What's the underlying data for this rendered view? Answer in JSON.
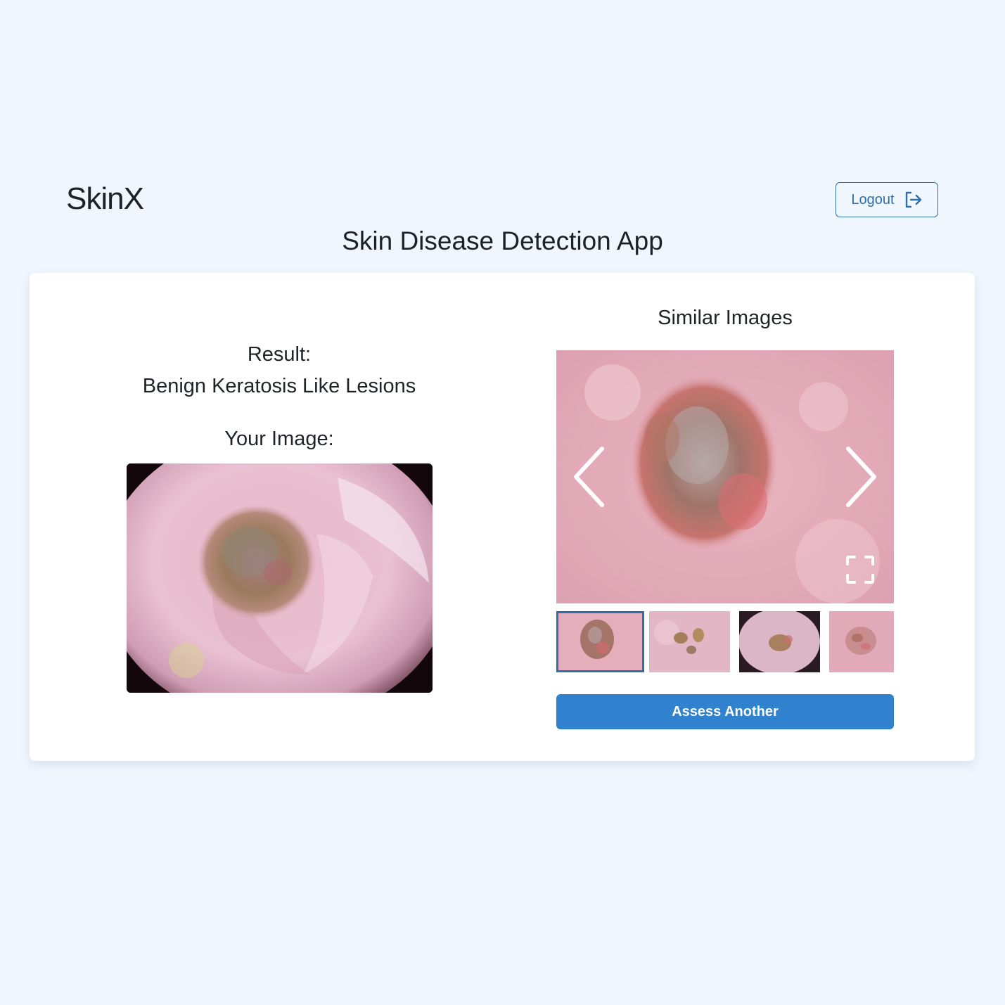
{
  "header": {
    "brand": "SkinX",
    "logout_label": "Logout",
    "logout_icon": "logout-icon",
    "app_title": "Skin Disease Detection App"
  },
  "result": {
    "label": "Result:",
    "value": "Benign Keratosis Like Lesions",
    "your_image_label": "Your Image:"
  },
  "similar": {
    "title": "Similar Images",
    "prev_icon": "chevron-left-icon",
    "next_icon": "chevron-right-icon",
    "fullscreen_icon": "fullscreen-icon",
    "active_index": 0,
    "thumbnail_count": 4
  },
  "actions": {
    "assess_label": "Assess Another"
  },
  "colors": {
    "background": "#eff6fe",
    "accent": "#3182ce",
    "outline": "#2f6ea8",
    "text": "#1d2229"
  }
}
